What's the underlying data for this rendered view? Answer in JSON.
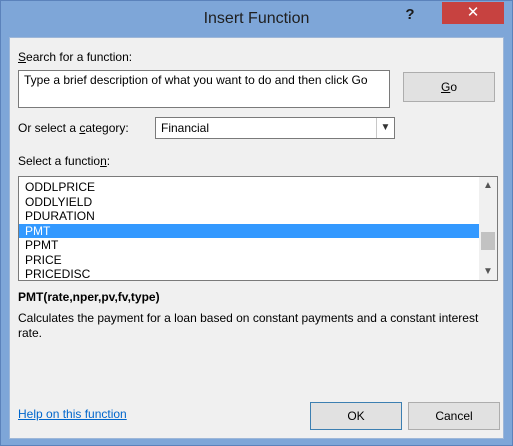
{
  "window": {
    "title": "Insert Function",
    "help_glyph": "?",
    "close_glyph": "✕"
  },
  "search": {
    "label": "Search for a function:",
    "value": "Type a brief description of what you want to do and then click Go",
    "go_label": "Go"
  },
  "category": {
    "label": "Or select a category:",
    "selected": "Financial"
  },
  "functions": {
    "label": "Select a function:",
    "items": [
      "ODDLPRICE",
      "ODDLYIELD",
      "PDURATION",
      "PMT",
      "PPMT",
      "PRICE",
      "PRICEDISC"
    ],
    "selected_index": 3
  },
  "details": {
    "signature": "PMT(rate,nper,pv,fv,type)",
    "description": "Calculates the payment for a loan based on constant payments and a constant interest rate."
  },
  "footer": {
    "help_link": "Help on this function",
    "ok_label": "OK",
    "cancel_label": "Cancel"
  },
  "colors": {
    "titlebar": "#7ea6d8",
    "close": "#c74240",
    "selection": "#3399ff",
    "link": "#0066cc"
  }
}
